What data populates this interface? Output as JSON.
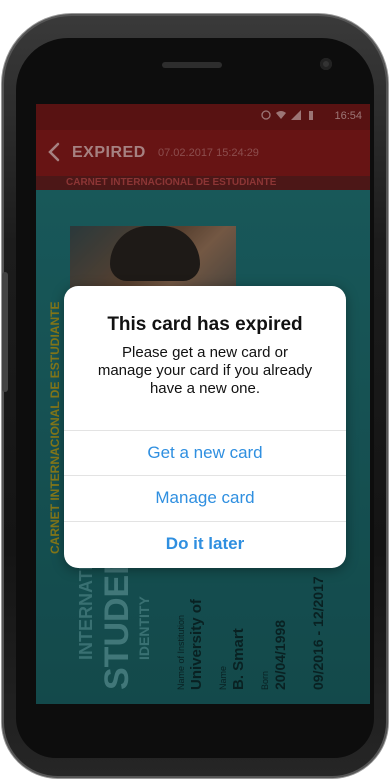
{
  "status_bar": {
    "time": "16:54"
  },
  "app_bar": {
    "title": "EXPIRED",
    "date": "07.02.2017  15:24:29"
  },
  "card": {
    "banner": "CARNET INTERNACIONAL DE ESTUDIANTE",
    "side_text": "CARNET INTERNACIONAL DE ESTUDIANTE",
    "big_line1": "INTERNATIONAL",
    "big_line2": "STUDENT",
    "big_line3": "IDENTITY",
    "info": {
      "institution_label": "Name of Institution",
      "institution": "University of",
      "name_label": "Name",
      "name": "B. Smart",
      "born_label": "Born",
      "born": "20/04/1998",
      "validity": "09/2016 - 12/2017"
    }
  },
  "dialog": {
    "title": "This card has expired",
    "message": "Please get a new card or manage your card if you already have a new one.",
    "buttons": {
      "get_new": "Get a new card",
      "manage": "Manage card",
      "later": "Do it later"
    }
  },
  "colors": {
    "link_blue": "#2f8fe0",
    "appbar_red": "#8f1d1d",
    "card_teal": "#227a7c"
  }
}
